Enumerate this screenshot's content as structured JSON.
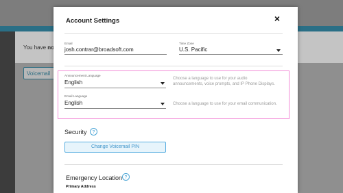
{
  "background": {
    "message_prefix": "You have ",
    "message_bold": "no s",
    "voicemail_button": "Voicemail"
  },
  "modal": {
    "title": "Account Settings",
    "close_icon": "×",
    "email": {
      "label": "Email",
      "value": "josh.contrar@broadsoft.com"
    },
    "time_zone": {
      "label": "Time Zone",
      "value": "U.S. Pacific"
    },
    "announcement_language": {
      "label": "Announcement Language",
      "value": "English",
      "help_line1": "Choose a language to use for your audio",
      "help_line2": "announcements, voice prompts, and IP Phone Displays."
    },
    "email_language": {
      "label": "Email Language",
      "value": "English",
      "help": "Choose a language to use for your email communication."
    },
    "security": {
      "title": "Security",
      "help_icon": "?",
      "change_pin_button": "Change Voicemail PIN"
    },
    "emergency": {
      "title": "Emergency Location",
      "help_icon": "?",
      "primary_address_label": "Primary Address"
    }
  },
  "colors": {
    "accent": "#4ba5d6",
    "highlight": "#f28ad6",
    "overlay_stripe": "#2a6f86"
  }
}
